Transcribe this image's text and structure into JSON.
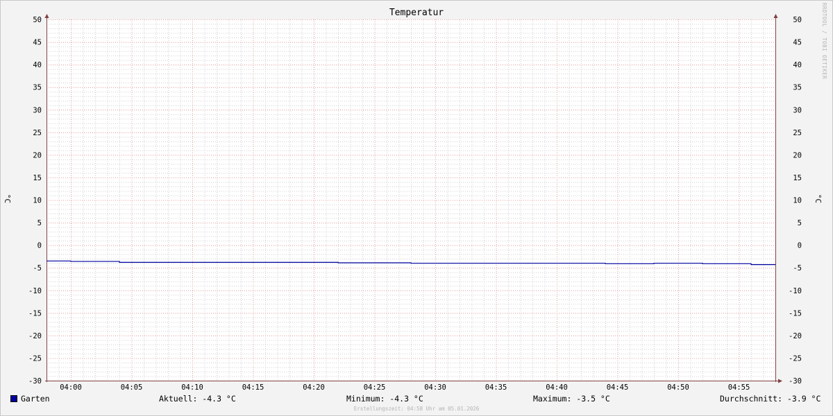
{
  "chart_data": {
    "type": "line",
    "title": "Temperatur",
    "ylabel": "°C",
    "ylim": [
      -30,
      50
    ],
    "yticks": [
      50,
      45,
      40,
      35,
      30,
      25,
      20,
      15,
      10,
      5,
      0,
      -5,
      -10,
      -15,
      -20,
      -25,
      -30
    ],
    "xlim": [
      "03:58",
      "04:58"
    ],
    "xticks": [
      "04:00",
      "04:05",
      "04:10",
      "04:15",
      "04:20",
      "04:25",
      "04:30",
      "04:35",
      "04:40",
      "04:45",
      "04:50",
      "04:55"
    ],
    "grid": true,
    "series": [
      {
        "name": "Garten",
        "color": "#0000a0",
        "points": [
          [
            "03:58",
            -3.5
          ],
          [
            "04:00",
            -3.5
          ],
          [
            "04:00",
            -3.6
          ],
          [
            "04:04",
            -3.6
          ],
          [
            "04:04",
            -3.8
          ],
          [
            "04:22",
            -3.8
          ],
          [
            "04:22",
            -3.9
          ],
          [
            "04:28",
            -3.9
          ],
          [
            "04:28",
            -4.0
          ],
          [
            "04:44",
            -4.0
          ],
          [
            "04:44",
            -4.1
          ],
          [
            "04:48",
            -4.1
          ],
          [
            "04:48",
            -4.0
          ],
          [
            "04:52",
            -4.0
          ],
          [
            "04:52",
            -4.1
          ],
          [
            "04:56",
            -4.1
          ],
          [
            "04:56",
            -4.3
          ],
          [
            "04:58",
            -4.3
          ]
        ]
      }
    ]
  },
  "watermark": "RRDTOOL / TOBI OETIKER",
  "legend": {
    "series_name": "Garten",
    "aktuell": "Aktuell: -4.3 °C",
    "minimum": "Minimum: -4.3 °C",
    "maximum": "Maximum: -3.5 °C",
    "durchschnitt": "Durchschnitt: -3.9 °C"
  },
  "footer": "Erstellungszeit: 04:58 Uhr am 05.01.2026",
  "colors": {
    "background": "#f3f3f3",
    "plot_background": "#ffffff",
    "minor_grid": "#cfcfcf",
    "major_grid": "#e8a0a0",
    "axis": "#804040",
    "series": "#0000a0"
  }
}
